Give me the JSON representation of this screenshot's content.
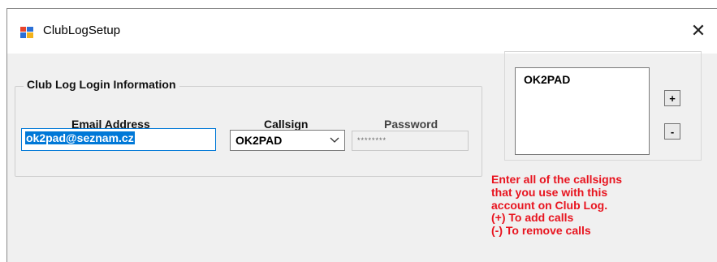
{
  "window": {
    "title": "ClubLogSetup",
    "close_glyph": "✕"
  },
  "login_group": {
    "legend": "Club Log Login Information",
    "email": {
      "label": "Email Address",
      "value": "ok2pad@seznam.cz"
    },
    "callsign": {
      "label": "Callsign",
      "value": "OK2PAD"
    },
    "password": {
      "label": "Password",
      "value": "********"
    }
  },
  "callsign_list": {
    "items": [
      "OK2PAD"
    ],
    "add_label": "+",
    "remove_label": "-"
  },
  "instructions": [
    "Enter all of the callsigns",
    "that you use with this",
    "account on Club Log.",
    "(+) To add calls",
    "(-) To remove calls"
  ],
  "colors": {
    "accent": "#0078d7",
    "instruction_text": "#e8141f",
    "window_bg": "#f0f0f0"
  },
  "icons": {
    "app": "app-window-icon",
    "close": "close-icon",
    "dropdown": "chevron-down-icon"
  }
}
